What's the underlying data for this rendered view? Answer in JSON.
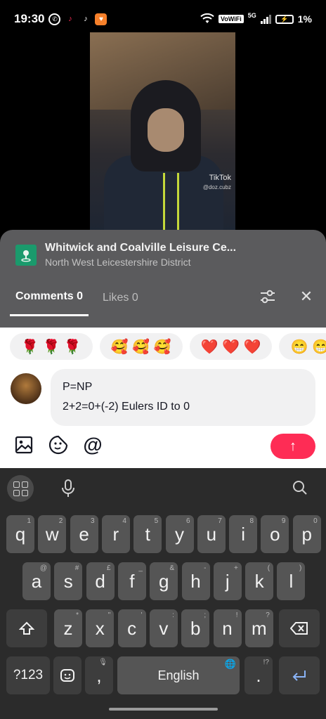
{
  "status_bar": {
    "time": "19:30",
    "battery": "1%",
    "network_badge": "VoWiFi",
    "network_type": "5G",
    "app_icons": [
      "whatsapp-icon",
      "tiktok-lite-icon",
      "tiktok-icon",
      "notification-app-icon"
    ]
  },
  "video": {
    "watermark_brand": "TikTok",
    "watermark_user": "@doz.cubz"
  },
  "location": {
    "title": "Whitwick and Coalville Leisure Ce...",
    "subtitle": "North West Leicestershire District"
  },
  "tabs": [
    {
      "label": "Comments 0",
      "active": true
    },
    {
      "label": "Likes 0",
      "active": false
    }
  ],
  "emoji_suggestions": [
    {
      "emojis": "🌹 🌹 🌹"
    },
    {
      "emojis": "🥰 🥰 🥰"
    },
    {
      "emojis": "❤️ ❤️ ❤️"
    },
    {
      "emojis": "😁 😁"
    }
  ],
  "comment_input": {
    "line1": "P=NP",
    "line2": "2+2=0+(-2) Eulers ID to 0"
  },
  "send_button": "↑",
  "keyboard": {
    "row1": [
      {
        "key": "q",
        "hint": "1"
      },
      {
        "key": "w",
        "hint": "2"
      },
      {
        "key": "e",
        "hint": "3"
      },
      {
        "key": "r",
        "hint": "4"
      },
      {
        "key": "t",
        "hint": "5"
      },
      {
        "key": "y",
        "hint": "6"
      },
      {
        "key": "u",
        "hint": "7"
      },
      {
        "key": "i",
        "hint": "8"
      },
      {
        "key": "o",
        "hint": "9"
      },
      {
        "key": "p",
        "hint": "0"
      }
    ],
    "row2": [
      {
        "key": "a",
        "hint": "@"
      },
      {
        "key": "s",
        "hint": "#"
      },
      {
        "key": "d",
        "hint": "£"
      },
      {
        "key": "f",
        "hint": "_"
      },
      {
        "key": "g",
        "hint": "&"
      },
      {
        "key": "h",
        "hint": "-"
      },
      {
        "key": "j",
        "hint": "+"
      },
      {
        "key": "k",
        "hint": "("
      },
      {
        "key": "l",
        "hint": ")"
      }
    ],
    "row3": [
      {
        "key": "z",
        "hint": "*"
      },
      {
        "key": "x",
        "hint": "\""
      },
      {
        "key": "c",
        "hint": "'"
      },
      {
        "key": "v",
        "hint": ":"
      },
      {
        "key": "b",
        "hint": ";"
      },
      {
        "key": "n",
        "hint": "!"
      },
      {
        "key": "m",
        "hint": "?"
      }
    ],
    "symbols_key": "?123",
    "comma_key": ",",
    "space_label": "English",
    "period_key": ".",
    "period_hint": "!?"
  }
}
